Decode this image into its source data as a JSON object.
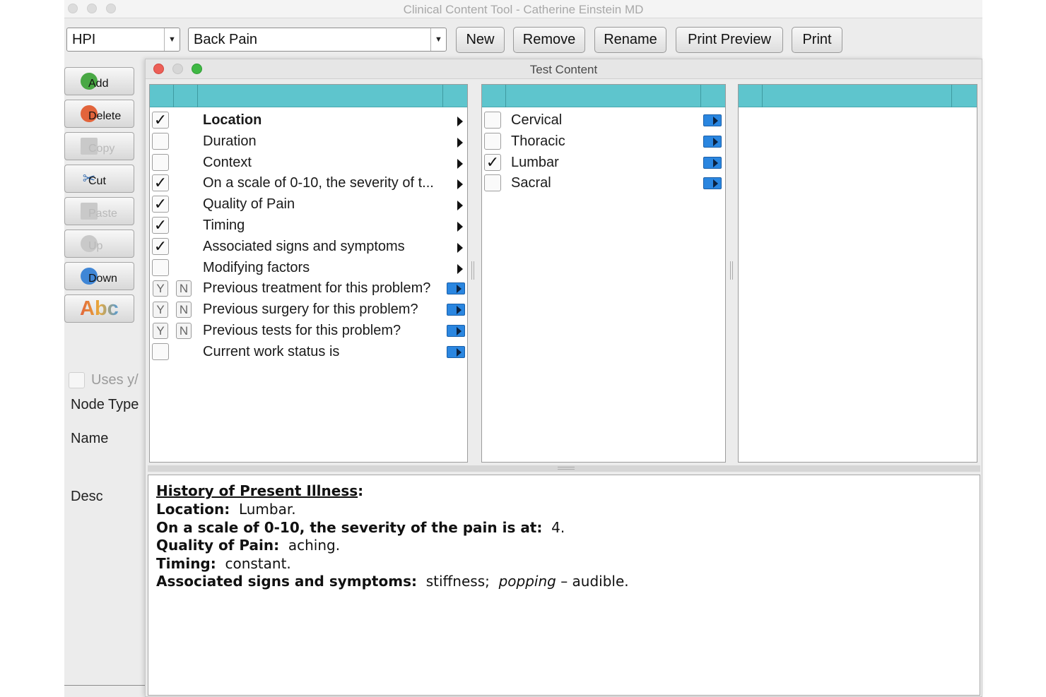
{
  "app": {
    "title": "Clinical Content Tool - Catherine Einstein MD"
  },
  "toolbar": {
    "section_select": "HPI",
    "template_select": "Back Pain",
    "buttons": {
      "new": "New",
      "remove": "Remove",
      "rename": "Rename",
      "print_preview": "Print Preview",
      "print": "Print"
    }
  },
  "side_buttons": {
    "add": "Add",
    "delete": "Delete",
    "copy": "Copy",
    "cut": "Cut",
    "paste": "Paste",
    "up": "Up",
    "down": "Down"
  },
  "left_panel": {
    "uses_yn_label": "Uses y/",
    "node_type_label": "Node Type",
    "name_label": "Name",
    "desc_label": "Desc",
    "spell_icon_text": "Abc"
  },
  "test_window": {
    "title": "Test Content"
  },
  "tree": {
    "col1": [
      {
        "label": "Location",
        "checked": true,
        "bold": true,
        "kind": "submenu"
      },
      {
        "label": "Duration",
        "checked": false,
        "bold": false,
        "kind": "submenu"
      },
      {
        "label": "Context",
        "checked": false,
        "bold": false,
        "kind": "submenu"
      },
      {
        "label": "On a scale of 0-10, the severity of t...",
        "checked": true,
        "bold": false,
        "kind": "submenu"
      },
      {
        "label": "Quality of Pain",
        "checked": true,
        "bold": false,
        "kind": "submenu"
      },
      {
        "label": "Timing",
        "checked": true,
        "bold": false,
        "kind": "submenu"
      },
      {
        "label": "Associated signs and symptoms",
        "checked": true,
        "bold": false,
        "kind": "submenu"
      },
      {
        "label": "Modifying factors",
        "checked": false,
        "bold": false,
        "kind": "submenu"
      },
      {
        "label": "Previous treatment for this problem?",
        "yn": true,
        "kind": "input"
      },
      {
        "label": "Previous surgery for this problem?",
        "yn": true,
        "kind": "input"
      },
      {
        "label": "Previous tests for this problem?",
        "yn": true,
        "kind": "input"
      },
      {
        "label": "Current work status is",
        "checked": false,
        "bold": false,
        "kind": "input"
      }
    ],
    "col2": [
      {
        "label": "Cervical",
        "checked": false
      },
      {
        "label": "Thoracic",
        "checked": false
      },
      {
        "label": "Lumbar",
        "checked": true
      },
      {
        "label": "Sacral",
        "checked": false
      }
    ],
    "yes_label": "Y",
    "no_label": "N",
    "check_mark": "✓"
  },
  "note": {
    "heading": "History of Present Illness",
    "heading_colon": ":",
    "lines": [
      {
        "label": "Location:",
        "value": "Lumbar."
      },
      {
        "label": "On a scale of 0-10, the severity of the pain is at:",
        "value": "4."
      },
      {
        "label": "Quality of Pain:",
        "value": "aching."
      },
      {
        "label": "Timing:",
        "value": "constant."
      }
    ],
    "assoc": {
      "label": "Associated signs and symptoms:",
      "v1": "stiffness;",
      "v2_italic": "popping",
      "v3": "– audible."
    }
  },
  "colors": {
    "header_teal": "#5ec5cd",
    "mic_blue": "#2a86e0",
    "close_red": "#ec5f57",
    "zoom_green": "#3fb844"
  }
}
